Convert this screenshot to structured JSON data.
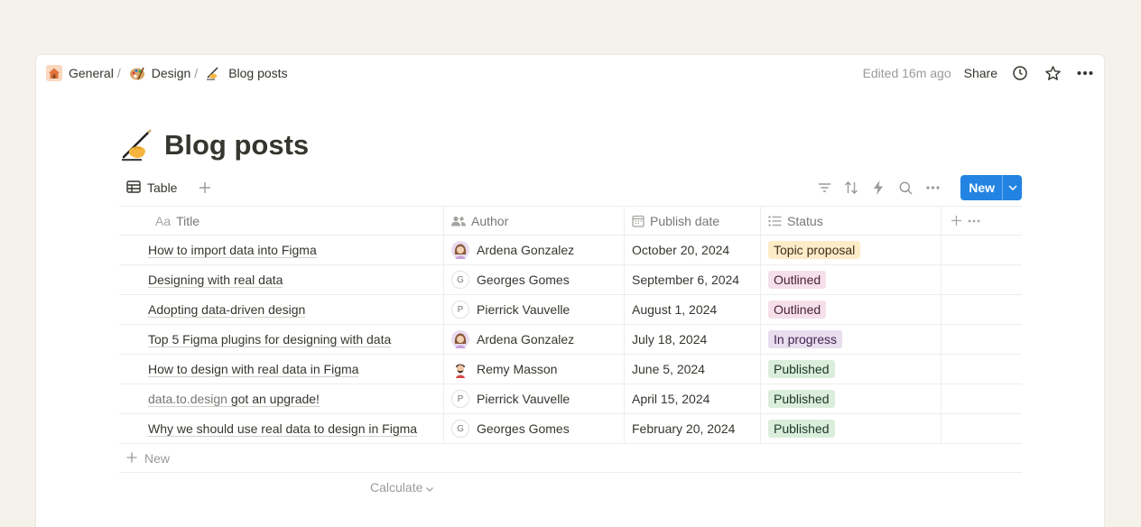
{
  "breadcrumb": [
    {
      "label": "General",
      "icon": "house-icon"
    },
    {
      "label": "Design",
      "icon": "palette-icon"
    },
    {
      "label": "Blog posts",
      "icon": "writing-hand-icon"
    }
  ],
  "topbar": {
    "edited": "Edited 16m ago",
    "share": "Share"
  },
  "page": {
    "emoji": "✍️",
    "title": "Blog posts"
  },
  "view": {
    "tab_label": "Table",
    "new_button": "New"
  },
  "columns": {
    "title": "Title",
    "title_prefix": "Aa",
    "author": "Author",
    "date": "Publish date",
    "status": "Status"
  },
  "rows": [
    {
      "title": "How to import data into Figma",
      "author": "Ardena Gonzalez",
      "avatar": "photo-woman",
      "date": "October 20, 2024",
      "status": "Topic proposal",
      "status_class": "s-topic"
    },
    {
      "title": "Designing with real data",
      "author": "Georges Gomes",
      "avatar": "G",
      "date": "September 6, 2024",
      "status": "Outlined",
      "status_class": "s-outlined"
    },
    {
      "title": "Adopting data-driven design",
      "author": "Pierrick Vauvelle",
      "avatar": "P",
      "date": "August 1, 2024",
      "status": "Outlined",
      "status_class": "s-outlined"
    },
    {
      "title": "Top 5 Figma plugins for designing with data",
      "author": "Ardena Gonzalez",
      "avatar": "photo-woman",
      "date": "July 18, 2024",
      "status": "In progress",
      "status_class": "s-progress"
    },
    {
      "title": "How to design with real data in Figma",
      "author": "Remy Masson",
      "avatar": "photo-man",
      "date": "June 5, 2024",
      "status": "Published",
      "status_class": "s-published"
    },
    {
      "title": "got an upgrade!",
      "title_link": "data.to.design",
      "author": "Pierrick Vauvelle",
      "avatar": "P",
      "date": "April 15, 2024",
      "status": "Published",
      "status_class": "s-published"
    },
    {
      "title": "Why we should use real data to design in Figma",
      "author": "Georges Gomes",
      "avatar": "G",
      "date": "February 20, 2024",
      "status": "Published",
      "status_class": "s-published"
    }
  ],
  "footer": {
    "new_row": "New",
    "calculate": "Calculate"
  },
  "colors": {
    "accent": "#2383e2",
    "background": "#f4f2eb"
  }
}
